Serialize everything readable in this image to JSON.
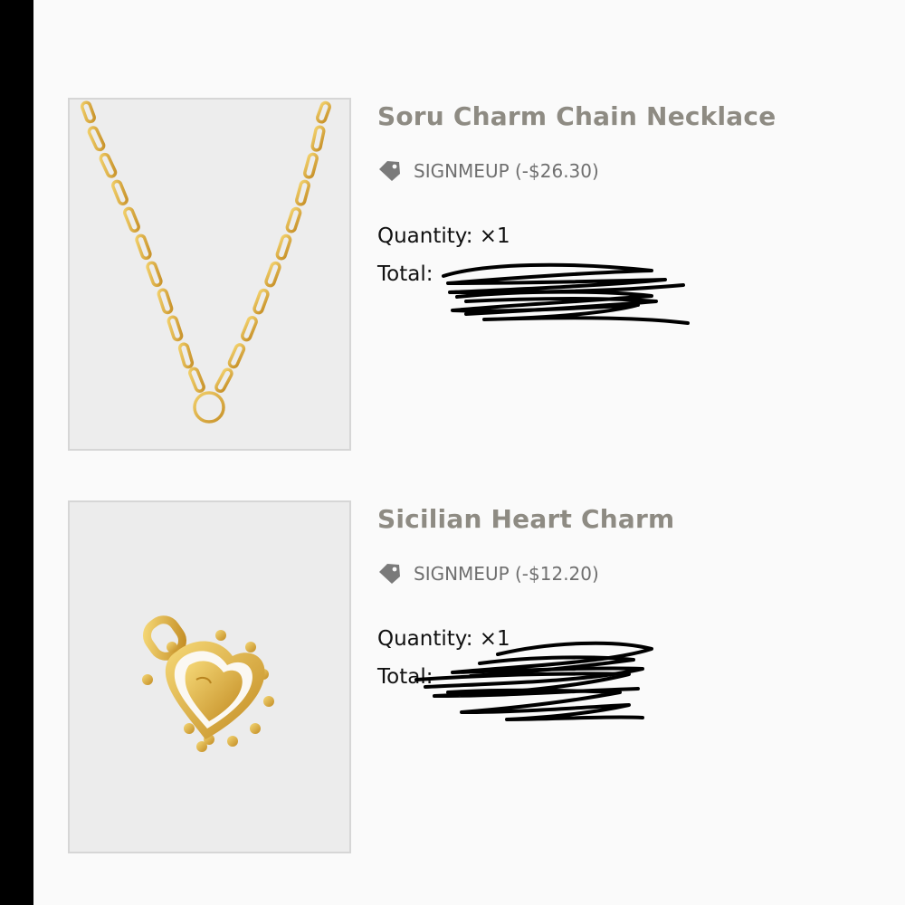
{
  "cart": {
    "items": [
      {
        "title": "Soru Charm Chain Necklace",
        "discount_icon": "tag-icon",
        "discount_text": "SIGNMEUP (-$26.30)",
        "quantity_label": "Quantity: ",
        "quantity_value": "×1",
        "total_label": "Total: "
      },
      {
        "title": "Sicilian Heart Charm",
        "discount_icon": "tag-icon",
        "discount_text": "SIGNMEUP (-$12.20)",
        "quantity_label": "Quantity: ",
        "quantity_value": "×1",
        "total_label": "Total: "
      }
    ]
  },
  "colors": {
    "title": "#8e8b83",
    "tag_icon": "#7a7a7a",
    "gold": "#d9a933",
    "redaction": "#000000",
    "left_bar": "#000000"
  }
}
